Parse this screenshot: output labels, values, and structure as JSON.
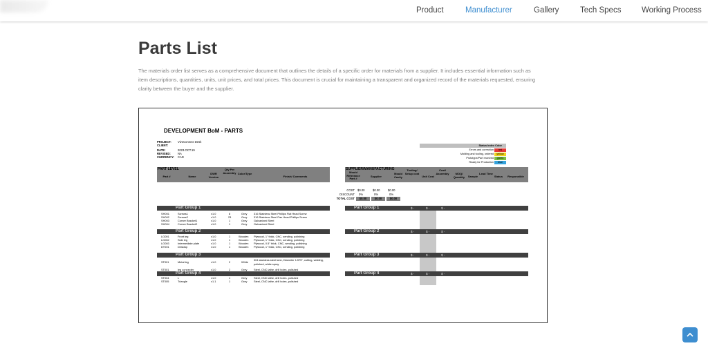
{
  "nav": {
    "items": [
      {
        "label": "Product",
        "active": false
      },
      {
        "label": "Manufacturer",
        "active": true
      },
      {
        "label": "Gallery",
        "active": false
      },
      {
        "label": "Tech Specs",
        "active": false
      },
      {
        "label": "Working Process",
        "active": false
      }
    ]
  },
  "page": {
    "title": "Parts List",
    "description": "The materials order list serves as a comprehensive document that outlines the details of a specific order for materials from a supplier. It includes essential information such as item descriptions, quantities, units, unit prices, and total prices. This document is crucial for maintaining a transparent and organized record of the materials requested, ensuring clarity between the buyer and the supplier."
  },
  "sheet": {
    "title": "DEVELOPMENT BoM - PARTS",
    "meta": [
      {
        "key": "PROJECT:",
        "value": "VivoConnect Desk"
      },
      {
        "key": "CLIENT:",
        "value": ""
      },
      {
        "key": "DATE:",
        "value": "2023.OCT.19"
      },
      {
        "key": "REVISED:",
        "value": "NA"
      },
      {
        "key": "CURRENCY:",
        "value": "CAD"
      }
    ],
    "status": {
      "header": "Status Index Color",
      "rows": [
        {
          "label": "Errors and correction",
          "value": "red",
          "color": "#e53935"
        },
        {
          "label": "Molding and tooling, ordered",
          "value": "yellow",
          "color": "#f2d41c"
        },
        {
          "label": "Prototype/Part received",
          "value": "green",
          "color": "#7cc242"
        },
        {
          "label": "Ready for Production",
          "value": "blue",
          "color": "#35a2dc"
        }
      ]
    },
    "part_level": {
      "title": "PART LEVEL",
      "columns": [
        "Part #",
        "Name",
        "DWR Version",
        "Qty Per Assembly",
        "Color/Type",
        "Finish/ Comments"
      ]
    },
    "supplier": {
      "title": "SUPPLIER/MANUFACTURING",
      "columns": [
        "Mould Referance Part #",
        "Supplier",
        "Mould Cavity",
        "Tooling/ Setup cost",
        "Unit Cost",
        "Cost/ Assembly",
        "MOQ/ Quantity",
        "Sample",
        "Lead Time",
        "Status",
        "Responsible"
      ]
    },
    "costs": {
      "rows": [
        {
          "label": "COST",
          "a": "$0.00",
          "b": "$0.00",
          "c": "$0.00"
        },
        {
          "label": "DISCOUNT",
          "a": "0%",
          "b": "0%",
          "c": "0%"
        },
        {
          "label": "TOTAL COST",
          "a": "$0.00",
          "b": "$0.00",
          "c": "$0.00"
        }
      ]
    },
    "dollar_cell": "$ -",
    "groups": [
      {
        "name": "Part Group 1",
        "rows": [
          {
            "part": "SH001",
            "name": "Screws1",
            "ver": "v1.0",
            "qty": "8",
            "color": "Grey",
            "finish": "316 Stainless Steel Phillips Flat Head Screw"
          },
          {
            "part": "SH002",
            "name": "Screws2",
            "ver": "v1.0",
            "qty": "23",
            "color": "Grey",
            "finish": "316 Stainless Steel Pan Head Phillips Screw"
          },
          {
            "part": "SH003",
            "name": "Corner Bracket1",
            "ver": "v1.0",
            "qty": "1",
            "color": "Grey",
            "finish": "Galvanized Steel"
          },
          {
            "part": "SH004",
            "name": "Corner Bracket2",
            "ver": "v1.0",
            "qty": "1",
            "color": "Grey",
            "finish": "Galvanized Steel"
          }
        ]
      },
      {
        "name": "Part Group 2",
        "rows": [
          {
            "part": "LG001",
            "name": "Front leg",
            "ver": "v1.0",
            "qty": "1",
            "color": "Wooden",
            "finish": "Plywood, 1\" thick, CNC, sending, polishing"
          },
          {
            "part": "LG002",
            "name": "Side leg",
            "ver": "v1.0",
            "qty": "1",
            "color": "Wooden",
            "finish": "Plywood, 1\" thick, CNC, sending, polishing"
          },
          {
            "part": "LG003",
            "name": "Intermediate plate",
            "ver": "v1.0",
            "qty": "1",
            "color": "Wooden",
            "finish": "Plywood, 0.5\" thick, CNC, sending, polishing"
          },
          {
            "part": "DT001",
            "name": "Desktop",
            "ver": "v1.0",
            "qty": "1",
            "color": "Wooden",
            "finish": "Plywood, 1\" thick, CNC, sending, polishing"
          }
        ]
      },
      {
        "name": "Part Group 3",
        "rows": [
          {
            "part": "ST001",
            "name": "Metal leg",
            "ver": "v1.0",
            "qty": "2",
            "color": "White",
            "finish": "304 stainless steel tube, Diameter 1.575\", cutting, welding, polished, white spray"
          },
          {
            "part": "ST001",
            "name": "leg connecter",
            "ver": "v1.0",
            "qty": "2",
            "color": "Grey",
            "finish": "Steel, CNC lathe, drill holes, polished"
          }
        ]
      },
      {
        "name": "Part Group 4",
        "rows": [
          {
            "part": "ST004",
            "name": "L",
            "ver": "v1.0",
            "qty": "1",
            "color": "Grey",
            "finish": "Steel, CNC lathe, drill holes, polished"
          },
          {
            "part": "ST005",
            "name": "Triangle",
            "ver": "v1.1",
            "qty": "1",
            "color": "Grey",
            "finish": "Steel, CNC lathe, drill holes, polished"
          }
        ]
      }
    ]
  },
  "colors": {
    "accent": "#3e8ed0",
    "group_bar": "#404040",
    "header_grey": "#808080"
  }
}
